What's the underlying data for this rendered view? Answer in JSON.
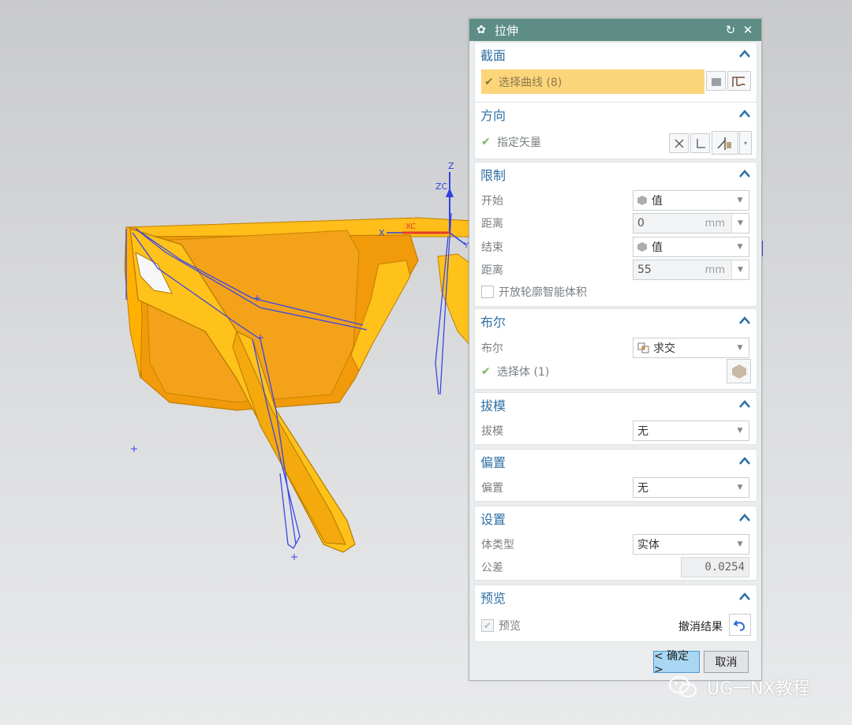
{
  "dialog": {
    "title": "拉伸",
    "sections": {
      "section": {
        "title": "截面",
        "select_curve": "选择曲线 (8)"
      },
      "direction": {
        "title": "方向",
        "specify_vector": "指定矢量"
      },
      "limits": {
        "title": "限制",
        "start_label": "开始",
        "start_value": "值",
        "start_distance_label": "距离",
        "start_distance": "0",
        "start_unit": "mm",
        "end_label": "结束",
        "end_value": "值",
        "end_distance_label": "距离",
        "end_distance": "55",
        "end_unit": "mm",
        "open_profile": "开放轮廓智能体积"
      },
      "boolean": {
        "title": "布尔",
        "boolean_label": "布尔",
        "boolean_value": "求交",
        "select_body": "选择体 (1)"
      },
      "draft": {
        "title": "拔模",
        "draft_label": "拔模",
        "draft_value": "无"
      },
      "offset": {
        "title": "偏置",
        "offset_label": "偏置",
        "offset_value": "无"
      },
      "settings": {
        "title": "设置",
        "body_type_label": "体类型",
        "body_type_value": "实体",
        "tolerance_label": "公差",
        "tolerance_value": "0.0254"
      },
      "preview": {
        "title": "预览",
        "preview_label": "预览",
        "undo_result": "撤消结果"
      }
    },
    "ok_button": "< 确定 >",
    "cancel_button": "取消"
  },
  "viewport": {
    "axis_labels": {
      "z": "Z",
      "zc": "ZC",
      "x": "X",
      "xc": "XC",
      "y": "Y"
    }
  },
  "watermark": {
    "text": "UG一NX教程"
  },
  "colors": {
    "title_bar": "#5d8d85",
    "section_heading": "#2d6fa3",
    "selection_highlight": "#fcd57a",
    "model_orange": "#f19a0a",
    "model_yellow": "#ffc21a",
    "sketch_curve": "#3a46e6"
  }
}
